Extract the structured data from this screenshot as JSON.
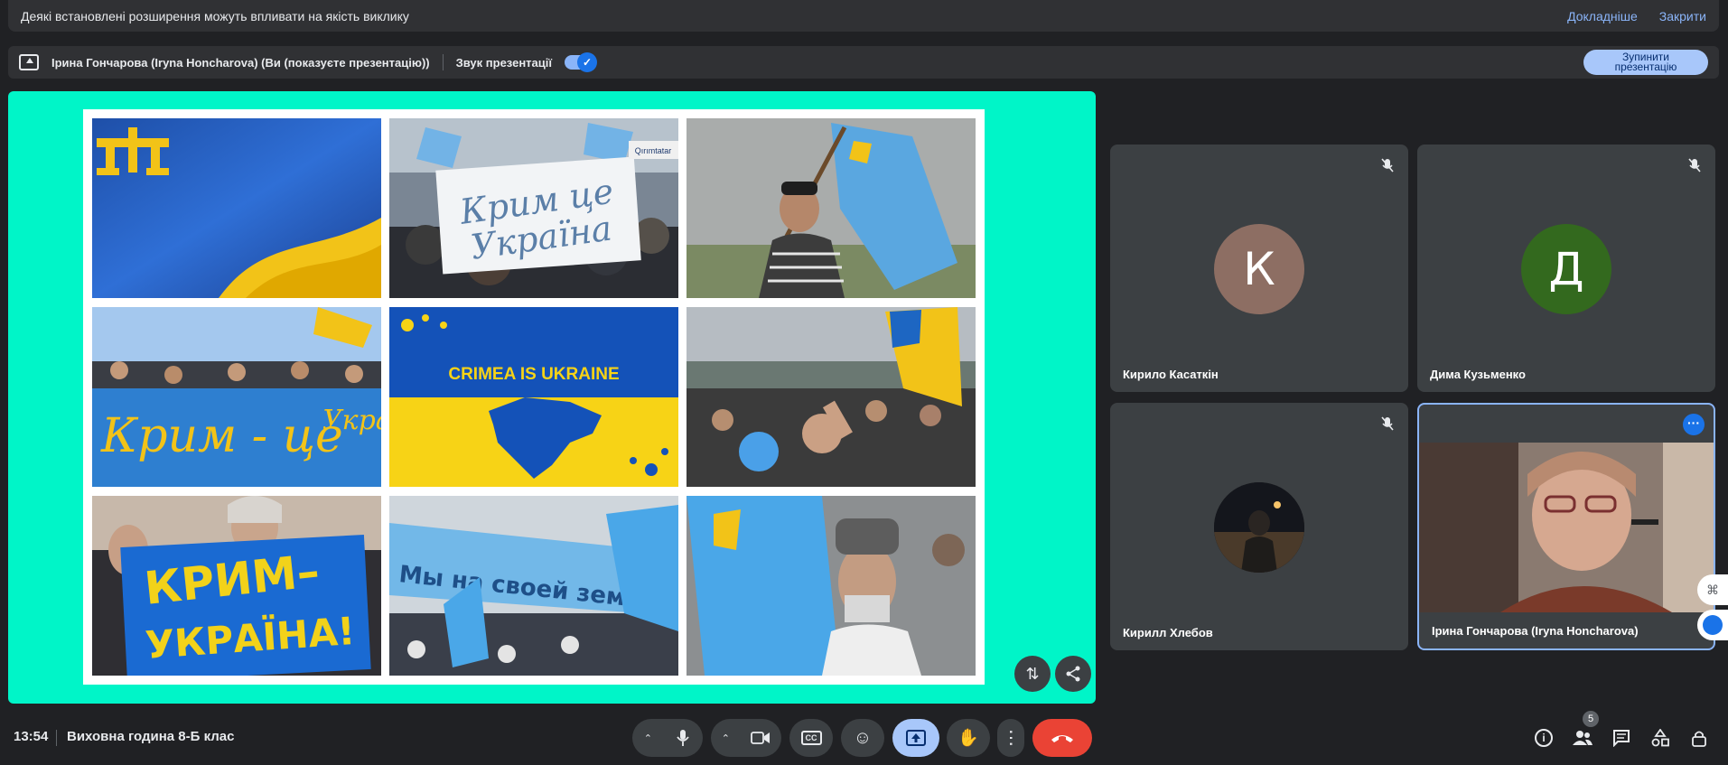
{
  "notification": {
    "message": "Деякі встановлені розширення можуть впливати на якість виклику",
    "learn_more": "Докладніше",
    "close": "Закрити"
  },
  "presenting": {
    "presenter": "Ірина Гончарова (Iryna Honcharova) (Ви (показуєте презентацію))",
    "audio_label": "Звук презентації",
    "audio_enabled": true,
    "stop_line1": "Зупинити",
    "stop_line2": "презентацію"
  },
  "slide": {
    "sign1_line1": "Крим це",
    "sign1_line2": "Україна",
    "banner_text": "CRIMEA IS UKRAINE",
    "sign2": "Крим - це",
    "sign2_tail": "Украї",
    "sign3_line1": "КРИМ–",
    "sign3_line2": "УКРАЇНА!",
    "sign4": "Мы на своей земле!",
    "qirim": "Qırımtatar"
  },
  "participants": [
    {
      "name": "Кирило Касаткін",
      "initial": "К",
      "color": "#8d6e63",
      "muted": true
    },
    {
      "name": "Дима Кузьменко",
      "initial": "Д",
      "color": "#33691e",
      "muted": true
    },
    {
      "name": "Кирилл Хлебов",
      "initial": "",
      "color": "#1b1b1b",
      "muted": true
    },
    {
      "name": "Ірина Гончарова (Iryna Honcharova)",
      "initial": "",
      "color": "#000",
      "muted": false
    }
  ],
  "bottom": {
    "time": "13:54",
    "meeting": "Виховна година 8-Б клас",
    "people_count": "5"
  },
  "icons": {
    "mic": "mic-icon",
    "camera": "camera-icon",
    "captions": "captions-icon",
    "emoji": "emoji-icon",
    "present": "present-icon",
    "hand": "raise-hand-icon",
    "more": "more-vert-icon",
    "hangup": "hangup-icon",
    "info": "info-icon",
    "people": "people-icon",
    "chat": "chat-icon",
    "activities": "activities-icon",
    "lock": "host-controls-icon"
  }
}
